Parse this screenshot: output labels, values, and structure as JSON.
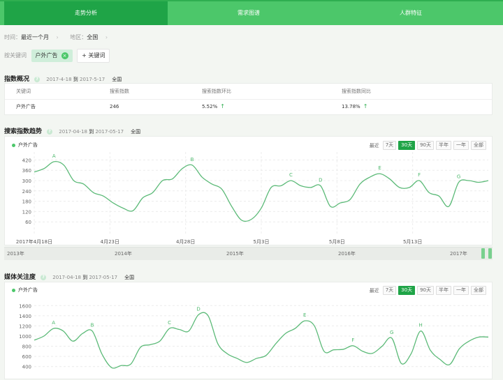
{
  "tabs": [
    {
      "label": "走势分析",
      "active": true
    },
    {
      "label": "需求图谱",
      "active": false
    },
    {
      "label": "人群特征",
      "active": false
    }
  ],
  "filters": {
    "time_label": "时间：",
    "time_value": "最近一个月",
    "region_label": "地区：",
    "region_value": "全国",
    "kw_label": "按关键词",
    "keyword": "户外广告",
    "add_keyword": "+ 关键词"
  },
  "overview": {
    "title": "指数概况",
    "date_from": "2017-4-18",
    "to": "到",
    "date_to": "2017-5-17",
    "region": "全国",
    "headers": [
      "关键词",
      "搜索指数",
      "搜索指数环比",
      "搜索指数同比"
    ],
    "row": {
      "keyword": "户外广告",
      "index": "246",
      "mom": "5.52%",
      "yoy": "13.78%"
    }
  },
  "trend": {
    "title": "搜索指数趋势",
    "date_from": "2017-04-18",
    "to": "到",
    "date_to": "2017-05-17",
    "region": "全国",
    "legend": "户外广告",
    "range_label": "最近",
    "range_buttons": [
      "7天",
      "30天",
      "90天",
      "半年",
      "一年",
      "全部"
    ],
    "range_active": "30天"
  },
  "navigator": {
    "years": [
      "2013年",
      "2014年",
      "2015年",
      "2016年",
      "2017年"
    ]
  },
  "media": {
    "title": "媒体关注度",
    "date_from": "2017-04-18",
    "to": "到",
    "date_to": "2017-05-17",
    "region": "全国",
    "legend": "户外广告",
    "range_label": "最近",
    "range_buttons": [
      "7天",
      "30天",
      "90天",
      "半年",
      "一年",
      "全部"
    ],
    "range_active": "30天"
  },
  "chart_data": [
    {
      "type": "line",
      "series": [
        {
          "name": "户外广告",
          "values": [
            350,
            370,
            410,
            390,
            300,
            280,
            230,
            210,
            170,
            140,
            125,
            200,
            230,
            300,
            310,
            370,
            390,
            320,
            280,
            250,
            150,
            70,
            75,
            140,
            260,
            270,
            300,
            270,
            260,
            270,
            150,
            170,
            190,
            280,
            320,
            340,
            310,
            260,
            260,
            300,
            230,
            210,
            150,
            290,
            300,
            290,
            300
          ]
        }
      ],
      "xticks": [
        "2017年4月18日",
        "4月23日",
        "4月28日",
        "5月3日",
        "5月8日",
        "5月13日"
      ],
      "yticks": [
        60,
        120,
        180,
        240,
        300,
        360,
        420
      ],
      "ylim": [
        0,
        450
      ],
      "annotations": [
        "A",
        "B",
        "C",
        "D",
        "E",
        "F",
        "G"
      ]
    },
    {
      "type": "line",
      "series": [
        {
          "name": "户外广告",
          "values": [
            920,
            1000,
            1150,
            1100,
            900,
            1050,
            1100,
            650,
            380,
            420,
            450,
            780,
            830,
            900,
            1150,
            1130,
            1100,
            1420,
            1400,
            850,
            650,
            560,
            480,
            560,
            620,
            850,
            1050,
            1150,
            1300,
            1200,
            700,
            730,
            740,
            810,
            700,
            660,
            800,
            960,
            460,
            650,
            1100,
            720,
            540,
            440,
            750,
            900,
            980,
            980
          ]
        }
      ],
      "yticks": [
        400,
        600,
        800,
        1000,
        1200,
        1400,
        1600
      ],
      "ylim": [
        300,
        1700
      ],
      "annotations": [
        "A",
        "B",
        "C",
        "D",
        "E",
        "F",
        "G",
        "H"
      ]
    }
  ]
}
